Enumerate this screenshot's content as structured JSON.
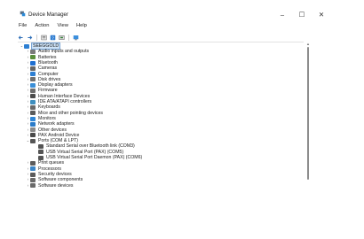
{
  "window": {
    "title": "Device Manager",
    "minimize_glyph": "–",
    "maximize_glyph": "☐",
    "close_glyph": "✕"
  },
  "menu": [
    "File",
    "Action",
    "View",
    "Help"
  ],
  "toolbar_icons": [
    "back-icon",
    "forward-icon",
    "properties-icon",
    "help-icon",
    "update-driver-icon",
    "scan-hardware-icon",
    "monitor-icon"
  ],
  "tree": {
    "root": "SEEGGOLD",
    "categories": [
      {
        "label": "Audio inputs and outputs",
        "icon": "speaker-icon",
        "color": "#7a7a7a",
        "expanded": false
      },
      {
        "label": "Batteries",
        "icon": "battery-icon",
        "color": "#5a8f3c",
        "expanded": false
      },
      {
        "label": "Bluetooth",
        "icon": "bluetooth-icon",
        "color": "#1f6fd1",
        "expanded": false
      },
      {
        "label": "Cameras",
        "icon": "camera-icon",
        "color": "#666666",
        "expanded": false
      },
      {
        "label": "Computer",
        "icon": "computer-icon",
        "color": "#2d7fd3",
        "expanded": false
      },
      {
        "label": "Disk drives",
        "icon": "disk-icon",
        "color": "#707070",
        "expanded": false
      },
      {
        "label": "Display adapters",
        "icon": "display-adapter-icon",
        "color": "#3a8fd8",
        "expanded": false
      },
      {
        "label": "Firmware",
        "icon": "firmware-icon",
        "color": "#6e6e6e",
        "expanded": false
      },
      {
        "label": "Human Interface Devices",
        "icon": "hid-icon",
        "color": "#4d4d4d",
        "expanded": false
      },
      {
        "label": "IDE ATA/ATAPI controllers",
        "icon": "ide-icon",
        "color": "#3f8fbf",
        "expanded": false
      },
      {
        "label": "Keyboards",
        "icon": "keyboard-icon",
        "color": "#6a6a6a",
        "expanded": false
      },
      {
        "label": "Mice and other pointing devices",
        "icon": "mouse-icon",
        "color": "#5b5b5b",
        "expanded": false
      },
      {
        "label": "Monitors",
        "icon": "monitor-icon",
        "color": "#2f86d6",
        "expanded": false
      },
      {
        "label": "Network adapters",
        "icon": "network-icon",
        "color": "#2a7bc9",
        "expanded": false
      },
      {
        "label": "Other devices",
        "icon": "other-devices-icon",
        "color": "#8a8a8a",
        "expanded": false
      },
      {
        "label": "PAX Android Device",
        "icon": "android-device-icon",
        "color": "#4a4a4a",
        "expanded": false
      },
      {
        "label": "Ports (COM & LPT)",
        "icon": "port-icon",
        "color": "#555555",
        "expanded": true,
        "children": [
          "Standard Serial over Bluetooth link (COM3)",
          "USB Virtual Serial Port (PAX) (COM5)",
          "USB Virtual Serial Port Daemon (PAX) (COM6)"
        ]
      },
      {
        "label": "Print queues",
        "icon": "printer-icon",
        "color": "#5c5c5c",
        "expanded": false
      },
      {
        "label": "Processors",
        "icon": "processor-icon",
        "color": "#3b86c8",
        "expanded": false
      },
      {
        "label": "Security devices",
        "icon": "security-icon",
        "color": "#5b5b5b",
        "expanded": false
      },
      {
        "label": "Software components",
        "icon": "software-component-icon",
        "color": "#6a6a6a",
        "expanded": false
      },
      {
        "label": "Software devices",
        "icon": "software-device-icon",
        "color": "#6a6a6a",
        "expanded": false
      }
    ]
  }
}
